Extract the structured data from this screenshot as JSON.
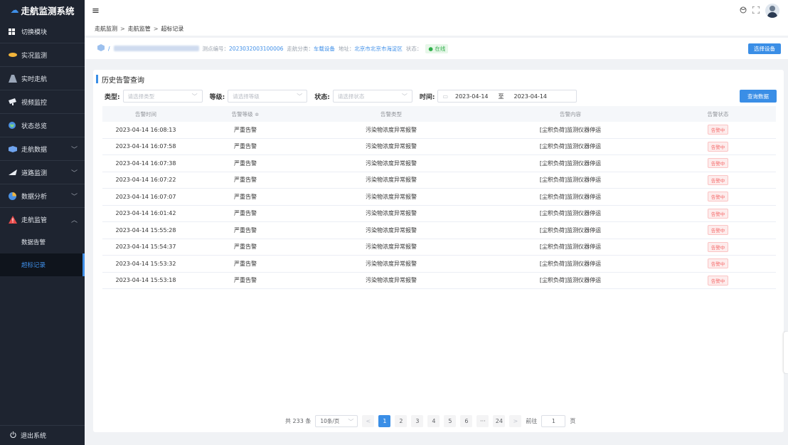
{
  "app": {
    "title": "走航监测系统"
  },
  "sidebar": {
    "items": [
      {
        "label": "切换模块",
        "icon": "grid-icon"
      },
      {
        "label": "实况监测",
        "icon": "monitor-icon"
      },
      {
        "label": "实时走航",
        "icon": "road-icon"
      },
      {
        "label": "视频监控",
        "icon": "camera-icon"
      },
      {
        "label": "状态总览",
        "icon": "globe-icon"
      },
      {
        "label": "走航数据",
        "icon": "data-icon"
      },
      {
        "label": "道路监测",
        "icon": "road-monitor-icon"
      },
      {
        "label": "数据分析",
        "icon": "pie-icon"
      },
      {
        "label": "走航监管",
        "icon": "warning-icon"
      }
    ],
    "subitems": [
      {
        "label": "数据告警"
      },
      {
        "label": "超标记录"
      }
    ],
    "logout": "退出系统"
  },
  "breadcrumb": [
    "走航监测",
    "走航监管",
    "超标记录"
  ],
  "info": {
    "point_label": "测点编号：",
    "point_value": "2023032003100006",
    "category_label": "走航分类：",
    "category_value": "车载设备",
    "address_label": "地址：",
    "address_value": "北京市北京市海淀区",
    "status_label": "状态：",
    "status_value": "● 在线",
    "select_device": "选择设备"
  },
  "card": {
    "title": "历史告警查询"
  },
  "filters": {
    "type_label": "类型:",
    "type_placeholder": "请选择类型",
    "level_label": "等级:",
    "level_placeholder": "请选择等级",
    "status_label": "状态:",
    "status_placeholder": "请选择状态",
    "time_label": "时间:",
    "date_start": "2023-04-14",
    "date_sep": "至",
    "date_end": "2023-04-14",
    "query_button": "查询数据"
  },
  "table": {
    "headers": [
      "告警时间",
      "告警等级 ≑",
      "告警类型",
      "告警内容",
      "告警状态"
    ],
    "rows": [
      [
        "2023-04-14 16:08:13",
        "严重告警",
        "污染物浓度异常报警",
        "[尘积负荷]监测仪器停运",
        "告警中"
      ],
      [
        "2023-04-14 16:07:58",
        "严重告警",
        "污染物浓度异常报警",
        "[尘积负荷]监测仪器停运",
        "告警中"
      ],
      [
        "2023-04-14 16:07:38",
        "严重告警",
        "污染物浓度异常报警",
        "[尘积负荷]监测仪器停运",
        "告警中"
      ],
      [
        "2023-04-14 16:07:22",
        "严重告警",
        "污染物浓度异常报警",
        "[尘积负荷]监测仪器停运",
        "告警中"
      ],
      [
        "2023-04-14 16:07:07",
        "严重告警",
        "污染物浓度异常报警",
        "[尘积负荷]监测仪器停运",
        "告警中"
      ],
      [
        "2023-04-14 16:01:42",
        "严重告警",
        "污染物浓度异常报警",
        "[尘积负荷]监测仪器停运",
        "告警中"
      ],
      [
        "2023-04-14 15:55:28",
        "严重告警",
        "污染物浓度异常报警",
        "[尘积负荷]监测仪器停运",
        "告警中"
      ],
      [
        "2023-04-14 15:54:37",
        "严重告警",
        "污染物浓度异常报警",
        "[尘积负荷]监测仪器停运",
        "告警中"
      ],
      [
        "2023-04-14 15:53:32",
        "严重告警",
        "污染物浓度异常报警",
        "[尘积负荷]监测仪器停运",
        "告警中"
      ],
      [
        "2023-04-14 15:53:18",
        "严重告警",
        "污染物浓度异常报警",
        "[尘积负荷]监测仪器停运",
        "告警中"
      ]
    ]
  },
  "pagination": {
    "total": "共 233 条",
    "page_size": "10条/页",
    "prev": "<",
    "pages": [
      "1",
      "2",
      "3",
      "4",
      "5",
      "6",
      "···",
      "24"
    ],
    "next": ">",
    "goto_label": "前往",
    "goto_value": "1",
    "goto_suffix": "页"
  },
  "colors": {
    "accent": "#3a8ee6",
    "sidebar_bg": "#1e2430",
    "alarm": "#f56c6c",
    "online": "#2fae4a"
  }
}
